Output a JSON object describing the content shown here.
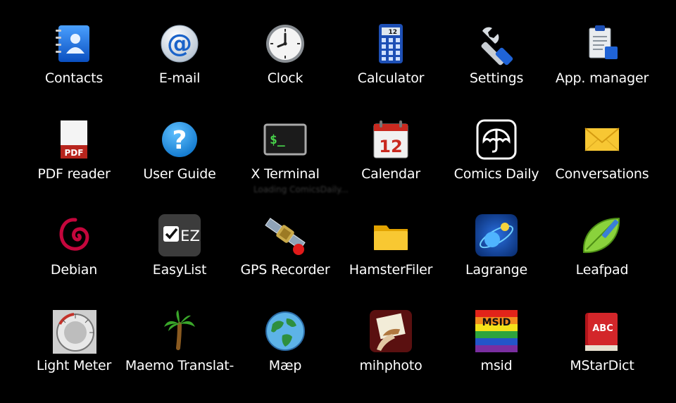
{
  "apps": [
    {
      "label": "Contacts",
      "icon": "contacts-icon"
    },
    {
      "label": "E-mail",
      "icon": "email-icon"
    },
    {
      "label": "Clock",
      "icon": "clock-icon"
    },
    {
      "label": "Calculator",
      "icon": "calculator-icon"
    },
    {
      "label": "Settings",
      "icon": "settings-icon"
    },
    {
      "label": "App. manager",
      "icon": "app-manager-icon"
    },
    {
      "label": "PDF reader",
      "icon": "pdf-reader-icon",
      "icon_text": "PDF"
    },
    {
      "label": "User Guide",
      "icon": "user-guide-icon",
      "icon_text": "?"
    },
    {
      "label": "X Terminal",
      "icon": "terminal-icon",
      "icon_text": "$_"
    },
    {
      "label": "Calendar",
      "icon": "calendar-icon",
      "icon_text": "12"
    },
    {
      "label": "Comics Daily",
      "icon": "comics-daily-icon"
    },
    {
      "label": "Conversations",
      "icon": "conversations-icon"
    },
    {
      "label": "Debian",
      "icon": "debian-icon"
    },
    {
      "label": "EasyList",
      "icon": "easylist-icon",
      "icon_text": "EZ"
    },
    {
      "label": "GPS Recorder",
      "icon": "gps-recorder-icon"
    },
    {
      "label": "HamsterFiler",
      "icon": "hamsterfiler-icon"
    },
    {
      "label": "Lagrange",
      "icon": "lagrange-icon"
    },
    {
      "label": "Leafpad",
      "icon": "leafpad-icon"
    },
    {
      "label": "Light Meter",
      "icon": "light-meter-icon"
    },
    {
      "label": "Maemo Translat-",
      "icon": "maemo-translate-icon"
    },
    {
      "label": "Mæp",
      "icon": "maep-icon"
    },
    {
      "label": "mihphoto",
      "icon": "mihphoto-icon"
    },
    {
      "label": "msid",
      "icon": "msid-icon",
      "icon_text": "MSID"
    },
    {
      "label": "MStarDict",
      "icon": "mstardict-icon",
      "icon_text": "ABC"
    }
  ],
  "loading_text": "Loading ComicsDaily..."
}
